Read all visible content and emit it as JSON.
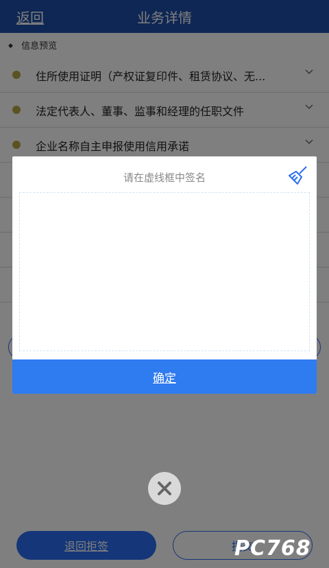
{
  "nav": {
    "back_label": "返回",
    "title": "业务详情"
  },
  "section": {
    "title": "信息预览"
  },
  "docs": [
    {
      "label": "住所使用证明（产权证复印件、租赁协议、无..."
    },
    {
      "label": "法定代表人、董事、监事和经理的任职文件"
    },
    {
      "label": "企业名称自主申报使用信用承诺"
    }
  ],
  "dialog": {
    "prompt": "请在虚线框中签名",
    "confirm_label": "确定"
  },
  "bottom": {
    "reject_label": "退回拒签",
    "submit_label": "提交"
  },
  "watermark": {
    "text": "PC768"
  },
  "colors": {
    "nav": "#1f4fa8",
    "primary": "#2a6df0",
    "dot": "#b4a642"
  },
  "icons": {
    "eraser": "broom-icon",
    "close": "close-icon",
    "chevron": "chevron-down-icon"
  }
}
